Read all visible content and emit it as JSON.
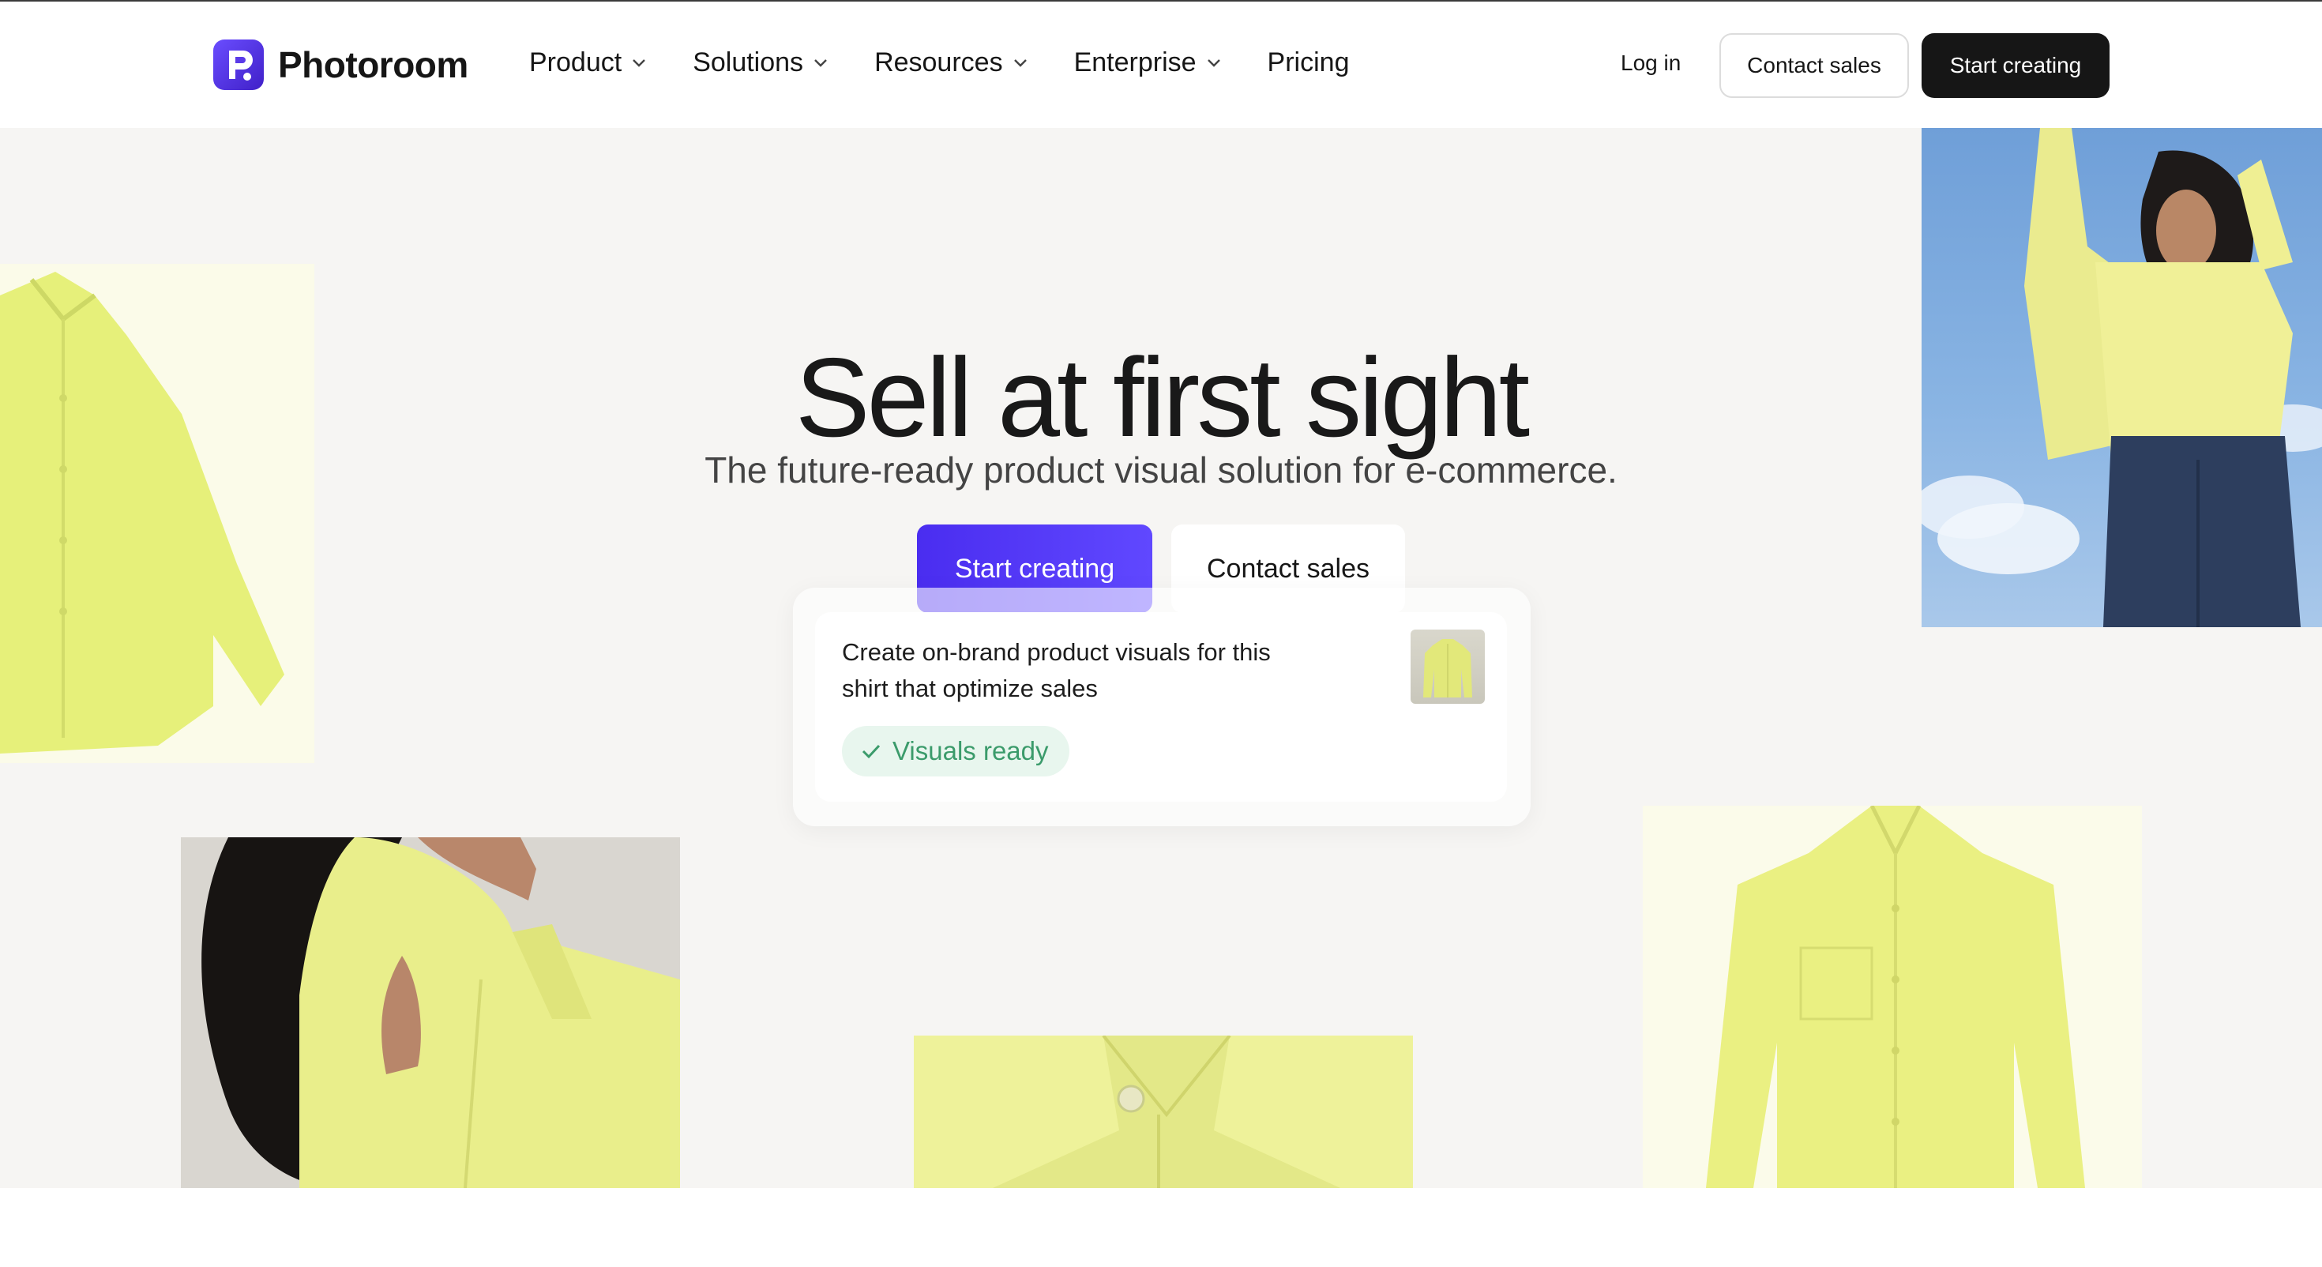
{
  "brand": {
    "name": "Photoroom",
    "accent": "#5b3df5"
  },
  "nav": {
    "items": [
      {
        "label": "Product",
        "dropdown": true
      },
      {
        "label": "Solutions",
        "dropdown": true
      },
      {
        "label": "Resources",
        "dropdown": true
      },
      {
        "label": "Enterprise",
        "dropdown": true
      },
      {
        "label": "Pricing",
        "dropdown": false
      }
    ],
    "login": "Log in",
    "contact_sales": "Contact sales",
    "start_creating": "Start creating"
  },
  "hero": {
    "title": "Sell at first sight",
    "subtitle": "The future-ready product visual solution for e-commerce.",
    "primary_cta": "Start creating",
    "secondary_cta": "Contact sales"
  },
  "prompt_card": {
    "text": "Create on-brand product visuals for this shirt that optimize sales",
    "status": "Visuals ready",
    "status_color": "#3b9b6b"
  },
  "icons": {
    "logo": "photoroom-logo-icon",
    "dropdown": "chevron-down-icon",
    "check": "check-icon"
  }
}
